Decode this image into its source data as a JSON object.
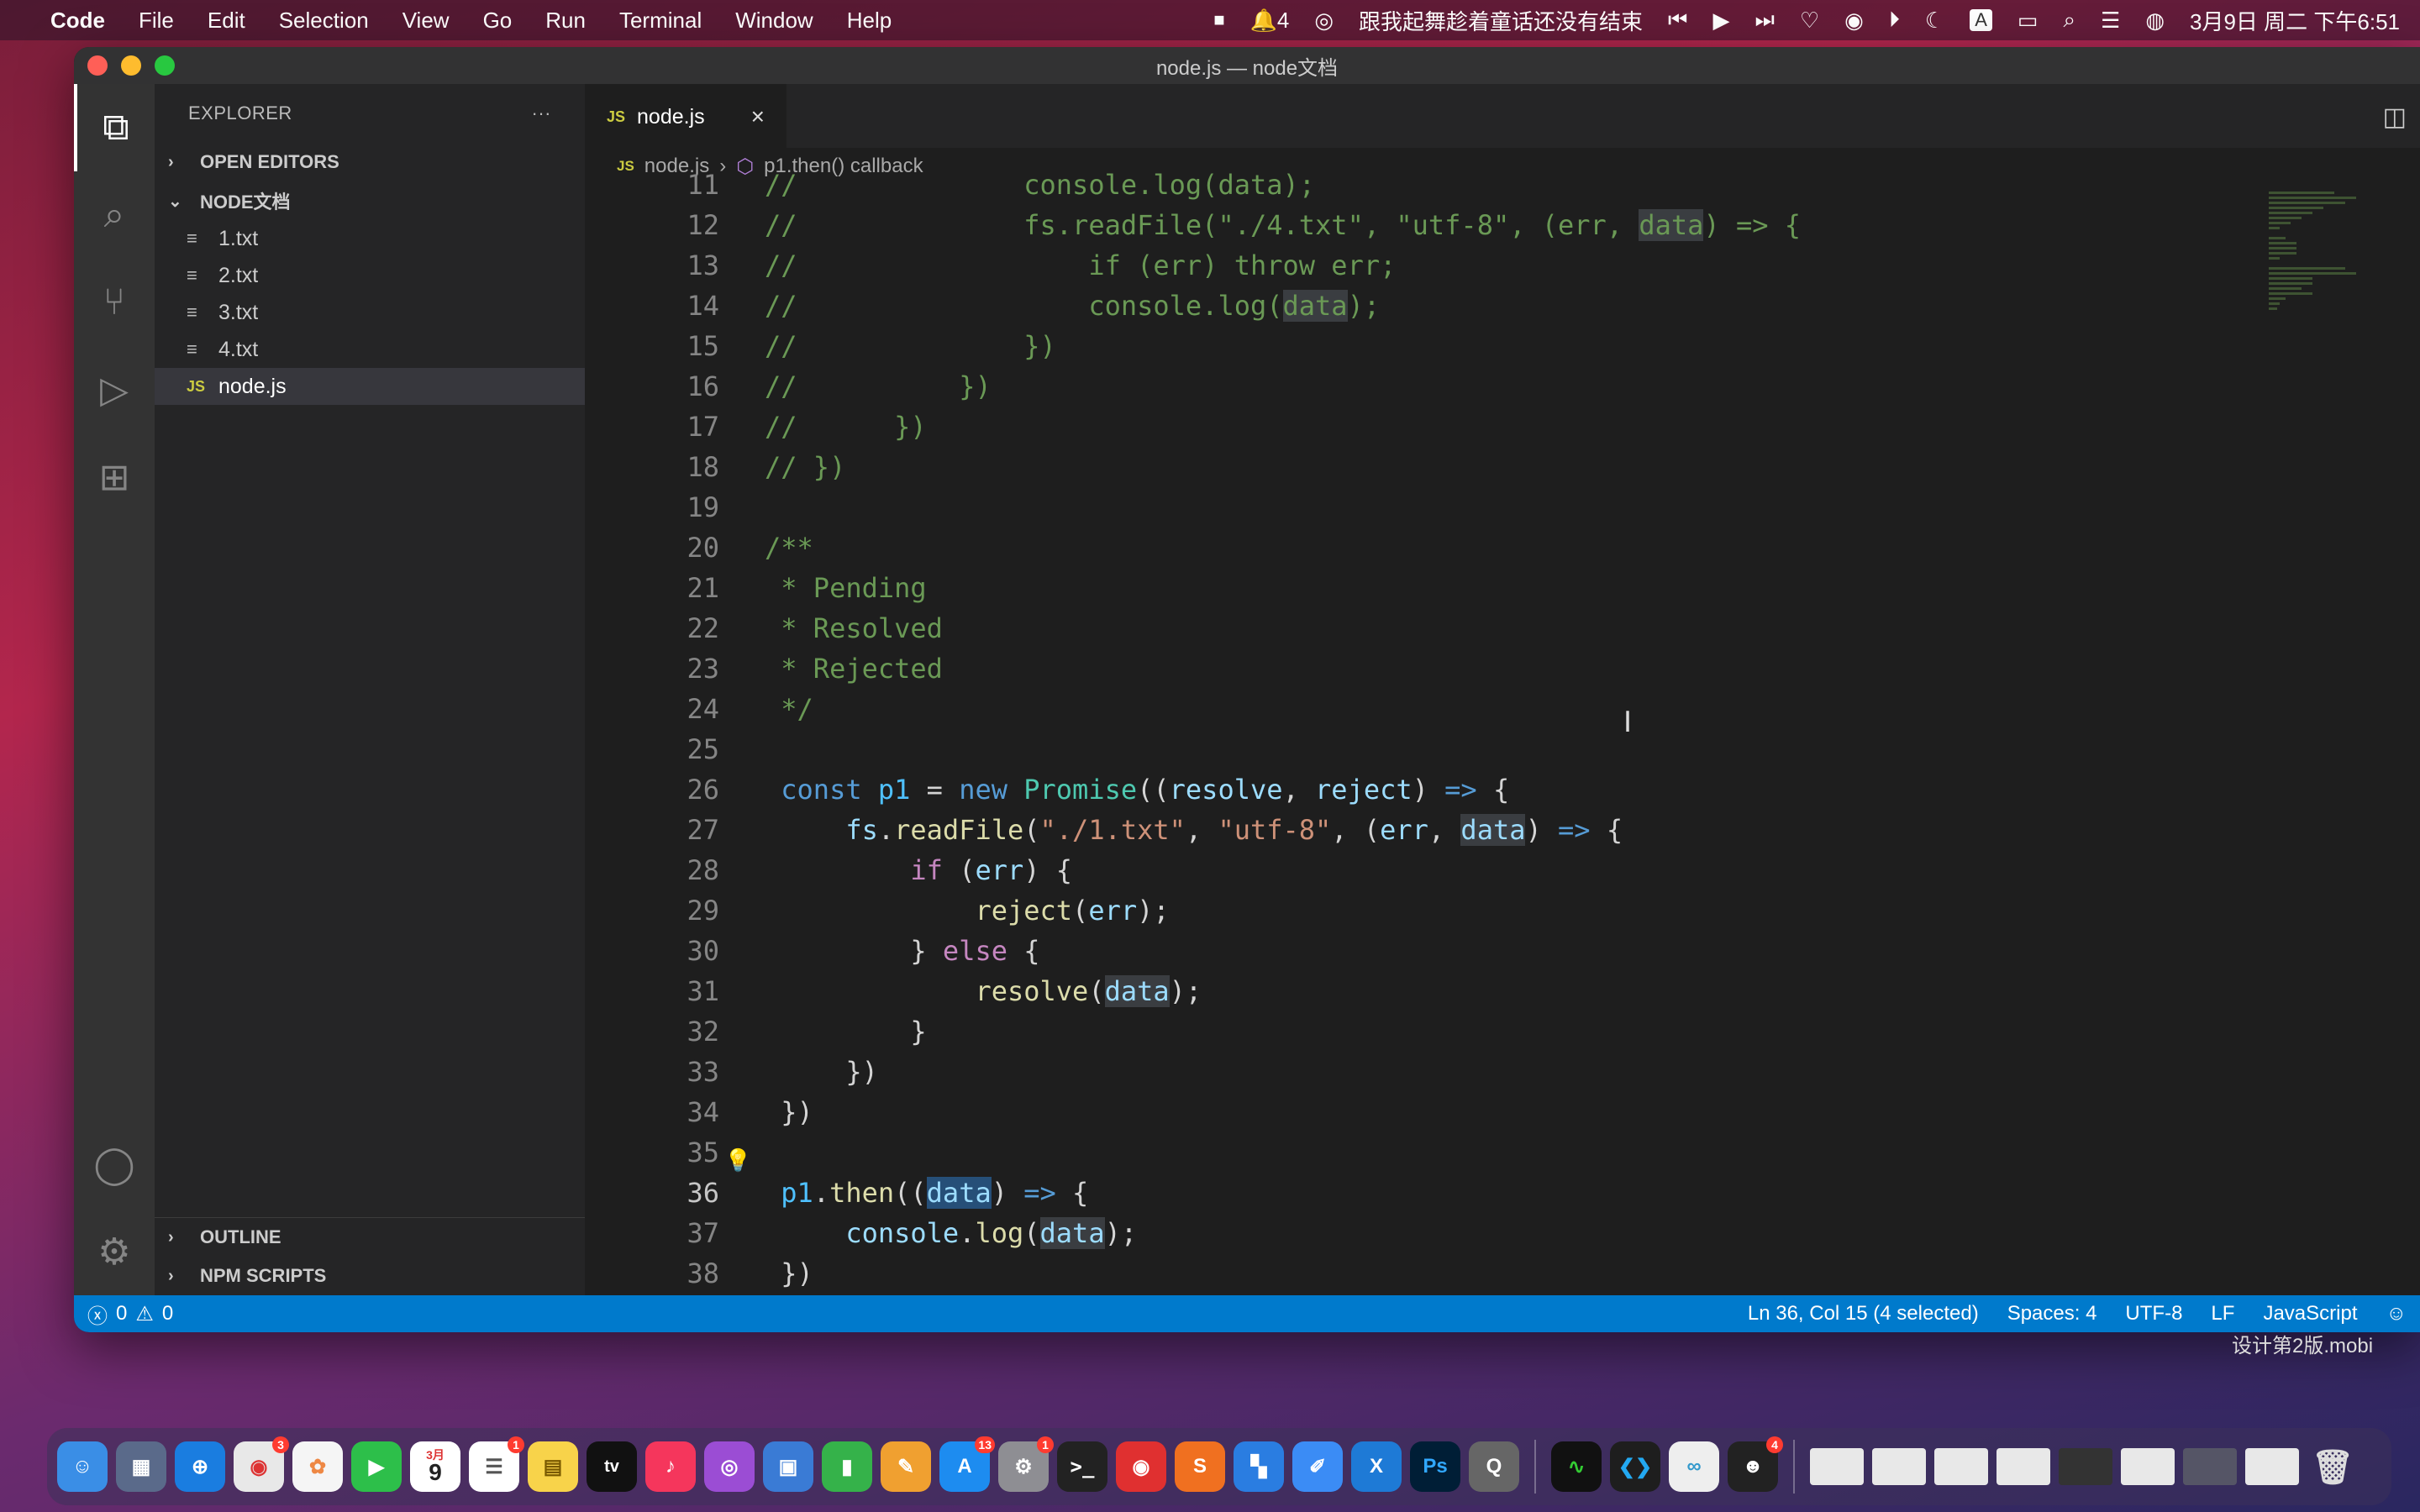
{
  "menubar": {
    "app": "Code",
    "items": [
      "File",
      "Edit",
      "Selection",
      "View",
      "Go",
      "Run",
      "Terminal",
      "Window",
      "Help"
    ],
    "notification_count": "4",
    "now_playing": "跟我起舞趁着童话还没有结束",
    "input_method": "A",
    "datetime": "3月9日 周二 下午6:51"
  },
  "window": {
    "title": "node.js — node文档"
  },
  "sidebar": {
    "header": "EXPLORER",
    "more": "···",
    "open_editors": "OPEN EDITORS",
    "folder": "NODE文档",
    "files": [
      "1.txt",
      "2.txt",
      "3.txt",
      "4.txt",
      "node.js"
    ],
    "outline": "OUTLINE",
    "npm_scripts": "NPM SCRIPTS"
  },
  "editor": {
    "tab_label": "node.js",
    "tab_lang_badge": "JS",
    "breadcrumb_file": "node.js",
    "breadcrumb_symbol": "p1.then() callback",
    "line_numbers": [
      "11",
      "12",
      "13",
      "14",
      "15",
      "16",
      "17",
      "18",
      "19",
      "20",
      "21",
      "22",
      "23",
      "24",
      "25",
      "26",
      "27",
      "28",
      "29",
      "30",
      "31",
      "32",
      "33",
      "34",
      "35",
      "36",
      "37",
      "38"
    ]
  },
  "statusbar": {
    "errors": "0",
    "warnings": "0",
    "position": "Ln 36, Col 15 (4 selected)",
    "spaces": "Spaces: 4",
    "encoding": "UTF-8",
    "eol": "LF",
    "language": "JavaScript"
  },
  "watermark": "设计第2版.mobi",
  "dock": {
    "calendar_day": "9",
    "calendar_month": "3月",
    "badges": {
      "chrome": "3",
      "reminders": "1",
      "appstore": "13",
      "settings": "1",
      "qq": "4"
    },
    "appletv": "tv",
    "photoshop": "Ps"
  },
  "colors": {
    "accent": "#007acc",
    "comment": "#6a9955",
    "keyword": "#569cd6",
    "string": "#ce9178"
  }
}
